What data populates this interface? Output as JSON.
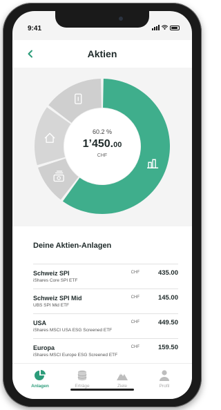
{
  "status_bar": {
    "time": "9:41"
  },
  "header": {
    "title": "Aktien",
    "back_icon": "chevron-left-icon"
  },
  "summary": {
    "percentage": "60.2 %",
    "amount_main": "1’450.",
    "amount_decimals": "00",
    "currency": "CHF"
  },
  "chart_data": {
    "type": "pie",
    "style": "donut",
    "segments": [
      {
        "icon": "chart-bars-icon",
        "value": 60.2,
        "color": "#3fae8c",
        "active": true
      },
      {
        "icon": "cash-stack-icon",
        "value": 10.0,
        "color": "#cfcfcf",
        "active": false
      },
      {
        "icon": "house-icon",
        "value": 14.9,
        "color": "#d6d6d6",
        "active": false
      },
      {
        "icon": "phone-icon",
        "value": 14.9,
        "color": "#cfcfcf",
        "active": false
      }
    ]
  },
  "holdings": {
    "heading": "Deine Aktien-Anlagen",
    "items": [
      {
        "name": "Schweiz SPI",
        "fund": "iShares Core SPI ETF",
        "currency": "CHF",
        "value": "435.00"
      },
      {
        "name": "Schweiz SPI Mid",
        "fund": "UBS SPI Mid ETF",
        "currency": "CHF",
        "value": "145.00"
      },
      {
        "name": "USA",
        "fund": "iShares MSCI USA ESG Screened ETF",
        "currency": "CHF",
        "value": "449.50"
      },
      {
        "name": "Europa",
        "fund": "iShares MSCI Europe ESG Screened ETF",
        "currency": "CHF",
        "value": "159.50"
      }
    ]
  },
  "tab_bar": {
    "tabs": [
      {
        "label": "Anlagen",
        "icon": "pie-chart-icon",
        "active": true
      },
      {
        "label": "Erträge",
        "icon": "coins-icon",
        "active": false
      },
      {
        "label": "Ziele",
        "icon": "mountain-icon",
        "active": false
      },
      {
        "label": "Profil",
        "icon": "person-icon",
        "active": false
      }
    ]
  },
  "colors": {
    "accent": "#3fae8c",
    "inactive": "#cfcfcf",
    "text": "#1f2a2a"
  }
}
